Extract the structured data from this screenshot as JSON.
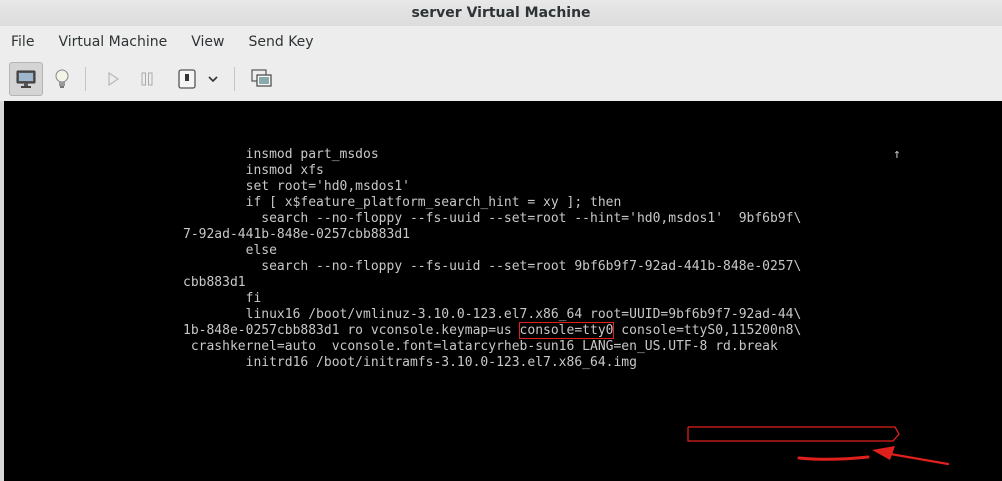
{
  "window": {
    "title": "server Virtual Machine"
  },
  "menu": {
    "items": [
      "File",
      "Virtual Machine",
      "View",
      "Send Key"
    ]
  },
  "toolbar": {
    "buttons": [
      {
        "name": "console-view",
        "icon": "monitor-icon",
        "active": true
      },
      {
        "name": "details-view",
        "icon": "lightbulb-icon",
        "active": false
      },
      {
        "name": "run",
        "icon": "play-icon",
        "active": false
      },
      {
        "name": "pause",
        "icon": "pause-icon",
        "active": false
      },
      {
        "name": "shutdown",
        "icon": "power-icon",
        "active": false
      },
      {
        "name": "shutdown-menu",
        "icon": "chevron-down-icon",
        "active": false
      },
      {
        "name": "fullscreen",
        "icon": "fullscreen-icon",
        "active": false
      }
    ]
  },
  "console": {
    "scroll_indicator": "↑",
    "lines": {
      "l1": "        insmod part_msdos",
      "l2": "        insmod xfs",
      "l3": "        set root='hd0,msdos1'",
      "l4": "        if [ x$feature_platform_search_hint = xy ]; then",
      "l5": "          search --no-floppy --fs-uuid --set=root --hint='hd0,msdos1'  9bf6b9f\\",
      "l6": "7-92ad-441b-848e-0257cbb883d1",
      "l7": "        else",
      "l8": "          search --no-floppy --fs-uuid --set=root 9bf6b9f7-92ad-441b-848e-0257\\",
      "l9": "cbb883d1",
      "l10": "        fi",
      "l11": "        linux16 /boot/vmlinuz-3.10.0-123.el7.x86_64 root=UUID=9bf6b9f7-92ad-44\\",
      "l12a": "1b-848e-0257cbb883d1 ro vconsole.keymap=us ",
      "l12b": "console=tty0",
      "l12c": " console=ttyS0,115200n8\\",
      "l13a": " crashkernel=auto  vconsole.font=latarcyrheb-sun16 LANG=en_US.UTF-8 ",
      "l13b": "rd.break",
      "l14": "        initrd16 /boot/initramfs-3.10.0-123.el7.x86_64.img"
    }
  },
  "colors": {
    "console_bg": "#000000",
    "console_fg": "#c8c8c8",
    "annotation_red": "#e0201c"
  }
}
